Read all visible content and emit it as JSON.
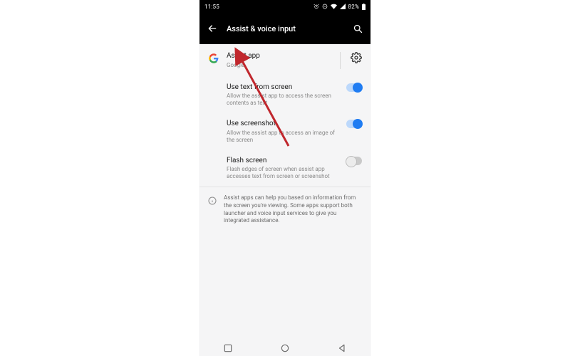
{
  "statusbar": {
    "time": "11:55",
    "battery_pct": "82%"
  },
  "appbar": {
    "title": "Assist & voice input"
  },
  "assist_row": {
    "title": "Assist app",
    "subtitle": "Google"
  },
  "settings": [
    {
      "title": "Use text from screen",
      "subtitle": "Allow the assist app to access the screen contents as text",
      "enabled": true
    },
    {
      "title": "Use screenshot",
      "subtitle": "Allow the assist app to access an image of the screen",
      "enabled": true
    },
    {
      "title": "Flash screen",
      "subtitle": "Flash edges of screen when assist app accesses text from screen or screenshot",
      "enabled": false
    }
  ],
  "info_text": "Assist apps can help you based on information from the screen you're viewing. Some apps support both launcher and voice input services to give you integrated assistance."
}
